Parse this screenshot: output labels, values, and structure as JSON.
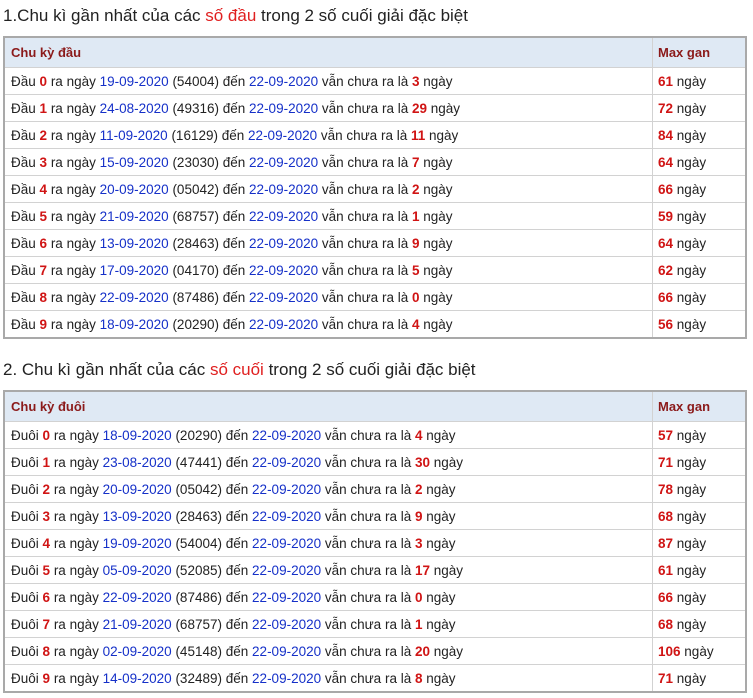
{
  "section1": {
    "title_pre": "1.Chu kì gần nhất của các ",
    "title_hl": "số đầu",
    "title_post": " trong 2 số cuối giải đặc biệt",
    "col1_header": "Chu kỳ đầu",
    "col2_header": "Max gan",
    "row_label": "Đầu",
    "rows": [
      {
        "digit": "0",
        "date": "19-09-2020",
        "code": "(54004)",
        "to_date": "22-09-2020",
        "days": "3",
        "max": "61"
      },
      {
        "digit": "1",
        "date": "24-08-2020",
        "code": "(49316)",
        "to_date": "22-09-2020",
        "days": "29",
        "max": "72"
      },
      {
        "digit": "2",
        "date": "11-09-2020",
        "code": "(16129)",
        "to_date": "22-09-2020",
        "days": "11",
        "max": "84"
      },
      {
        "digit": "3",
        "date": "15-09-2020",
        "code": "(23030)",
        "to_date": "22-09-2020",
        "days": "7",
        "max": "64"
      },
      {
        "digit": "4",
        "date": "20-09-2020",
        "code": "(05042)",
        "to_date": "22-09-2020",
        "days": "2",
        "max": "66"
      },
      {
        "digit": "5",
        "date": "21-09-2020",
        "code": "(68757)",
        "to_date": "22-09-2020",
        "days": "1",
        "max": "59"
      },
      {
        "digit": "6",
        "date": "13-09-2020",
        "code": "(28463)",
        "to_date": "22-09-2020",
        "days": "9",
        "max": "64"
      },
      {
        "digit": "7",
        "date": "17-09-2020",
        "code": "(04170)",
        "to_date": "22-09-2020",
        "days": "5",
        "max": "62"
      },
      {
        "digit": "8",
        "date": "22-09-2020",
        "code": "(87486)",
        "to_date": "22-09-2020",
        "days": "0",
        "max": "66"
      },
      {
        "digit": "9",
        "date": "18-09-2020",
        "code": "(20290)",
        "to_date": "22-09-2020",
        "days": "4",
        "max": "56"
      }
    ]
  },
  "section2": {
    "title_pre": "2. Chu kì gần nhất của các ",
    "title_hl": "số cuối",
    "title_post": " trong 2 số cuối giải đặc biệt",
    "col1_header": "Chu kỳ đuôi",
    "col2_header": "Max gan",
    "row_label": "Đuôi",
    "rows": [
      {
        "digit": "0",
        "date": "18-09-2020",
        "code": "(20290)",
        "to_date": "22-09-2020",
        "days": "4",
        "max": "57"
      },
      {
        "digit": "1",
        "date": "23-08-2020",
        "code": "(47441)",
        "to_date": "22-09-2020",
        "days": "30",
        "max": "71"
      },
      {
        "digit": "2",
        "date": "20-09-2020",
        "code": "(05042)",
        "to_date": "22-09-2020",
        "days": "2",
        "max": "78"
      },
      {
        "digit": "3",
        "date": "13-09-2020",
        "code": "(28463)",
        "to_date": "22-09-2020",
        "days": "9",
        "max": "68"
      },
      {
        "digit": "4",
        "date": "19-09-2020",
        "code": "(54004)",
        "to_date": "22-09-2020",
        "days": "3",
        "max": "87"
      },
      {
        "digit": "5",
        "date": "05-09-2020",
        "code": "(52085)",
        "to_date": "22-09-2020",
        "days": "17",
        "max": "61"
      },
      {
        "digit": "6",
        "date": "22-09-2020",
        "code": "(87486)",
        "to_date": "22-09-2020",
        "days": "0",
        "max": "66"
      },
      {
        "digit": "7",
        "date": "21-09-2020",
        "code": "(68757)",
        "to_date": "22-09-2020",
        "days": "1",
        "max": "68"
      },
      {
        "digit": "8",
        "date": "02-09-2020",
        "code": "(45148)",
        "to_date": "22-09-2020",
        "days": "20",
        "max": "106"
      },
      {
        "digit": "9",
        "date": "14-09-2020",
        "code": "(32489)",
        "to_date": "22-09-2020",
        "days": "8",
        "max": "71"
      }
    ]
  },
  "text": {
    "ra_ngay": "ra ngày",
    "den": "đến",
    "van_chua": "vẫn chưa ra là",
    "ngay": "ngày"
  },
  "colors": {
    "highlight": "#e02020",
    "number": "#d01414",
    "date": "#1530c8",
    "header_text": "#8b1a1a",
    "header_bg": "#dfe9f4"
  }
}
